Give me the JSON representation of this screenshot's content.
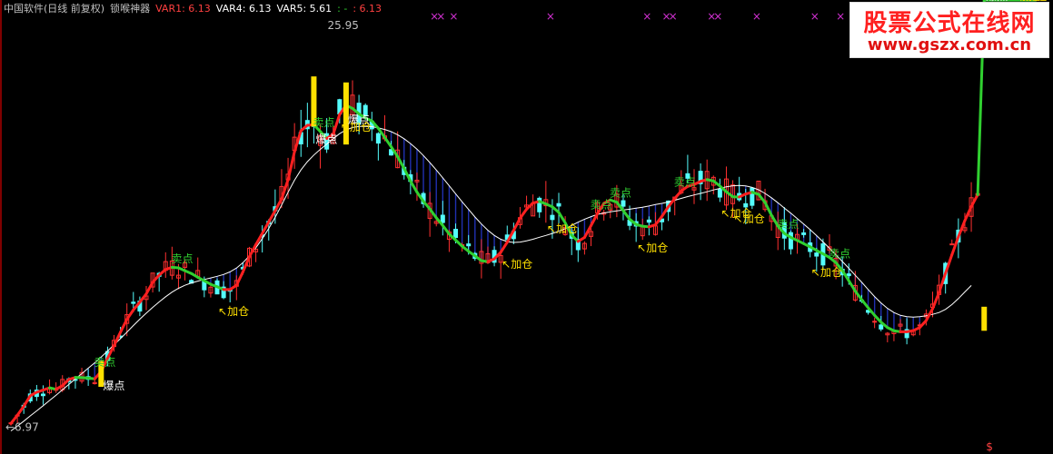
{
  "header": {
    "title": "中国软件(日线 前复权)",
    "indicator": "锁喉神器",
    "var1_label": "VAR1: 6.13",
    "var4_label": "VAR4: 6.13",
    "var5_label": "VAR5: 5.61",
    "extra_label": ": -",
    "extra_value": ": 6.13"
  },
  "watermark": {
    "title": "股票公式在线网",
    "url": "www.gszx.com.cn"
  },
  "colors": {
    "bg": "#000000",
    "up": "#ff3030",
    "down": "#54fcfc",
    "trend_up": "#ff2020",
    "trend_down": "#30d030",
    "slow_line": "#ffffff",
    "fill": "#2030b0",
    "burst_bar": "#ffe000",
    "label_yellow": "#ffffff",
    "label_green": "#30d030",
    "label_jiacang": "#ffe000",
    "header_gray": "#c0c0c0",
    "header_red": "#ff4040",
    "header_white": "#ffffff",
    "header_green": "#30d030"
  },
  "chart_data": {
    "type": "candlestick",
    "title": "中国软件(日线 前复权)",
    "y_high_label": "25.95",
    "y_low_label": "6.97",
    "ylim": [
      5.9,
      27.3
    ],
    "n_bars": 160,
    "trend_line": [
      6.97,
      7.38,
      7.83,
      8.35,
      8.53,
      8.64,
      8.75,
      8.68,
      8.86,
      9.17,
      9.27,
      9.26,
      9.24,
      9.2,
      9.57,
      10.23,
      10.86,
      11.53,
      12.17,
      12.64,
      13.03,
      13.44,
      14.02,
      14.38,
      14.66,
      14.77,
      14.74,
      14.6,
      14.46,
      14.27,
      14.1,
      13.92,
      13.8,
      13.66,
      13.66,
      13.87,
      14.54,
      15.3,
      15.9,
      16.46,
      17.03,
      17.59,
      18.19,
      19.14,
      20.54,
      21.59,
      21.86,
      21.89,
      21.55,
      21.2,
      21.41,
      22.4,
      22.86,
      22.7,
      22.43,
      22.22,
      22.08,
      21.71,
      21.25,
      20.79,
      20.29,
      19.71,
      19.07,
      18.52,
      18.06,
      17.68,
      17.24,
      16.86,
      16.43,
      16.13,
      15.82,
      15.57,
      15.34,
      15.1,
      15.05,
      15.19,
      15.52,
      16.02,
      16.61,
      17.22,
      17.67,
      17.98,
      18.06,
      17.93,
      17.79,
      17.51,
      16.99,
      16.37,
      16.06,
      16.26,
      16.85,
      17.45,
      17.96,
      18.13,
      18.02,
      17.6,
      17.17,
      16.91,
      16.82,
      16.79,
      16.89,
      17.31,
      17.79,
      18.21,
      18.58,
      18.81,
      18.9,
      19.06,
      19.15,
      19.08,
      18.83,
      18.54,
      18.29,
      18.28,
      18.43,
      18.52,
      18.41,
      18.01,
      17.37,
      16.83,
      16.46,
      16.26,
      16.11,
      15.95,
      15.79,
      15.61,
      15.44,
      15.26,
      15.0,
      14.61,
      14.1,
      13.58,
      13.15,
      12.75,
      12.37,
      12.03,
      11.76,
      11.6,
      11.55,
      11.55,
      11.61,
      11.76,
      12.11,
      12.7,
      13.51,
      14.47,
      15.4,
      16.29,
      17.1,
      17.8,
      18.4
    ],
    "slow_line": [
      6.6,
      6.84,
      7.09,
      7.35,
      7.6,
      7.86,
      8.12,
      8.38,
      8.65,
      8.92,
      9.19,
      9.46,
      9.73,
      10.0,
      10.29,
      10.59,
      10.9,
      11.21,
      11.53,
      11.86,
      12.18,
      12.48,
      12.77,
      13.04,
      13.3,
      13.53,
      13.72,
      13.87,
      13.99,
      14.08,
      14.16,
      14.24,
      14.32,
      14.41,
      14.54,
      14.73,
      15.0,
      15.34,
      15.74,
      16.2,
      16.71,
      17.27,
      17.88,
      18.52,
      19.12,
      19.63,
      20.04,
      20.37,
      20.66,
      20.92,
      21.19,
      21.44,
      21.63,
      21.75,
      21.8,
      21.8,
      21.79,
      21.73,
      21.65,
      21.54,
      21.39,
      21.19,
      20.95,
      20.67,
      20.35,
      20.0,
      19.63,
      19.24,
      18.84,
      18.44,
      18.04,
      17.66,
      17.28,
      16.93,
      16.62,
      16.36,
      16.17,
      16.05,
      16.01,
      16.03,
      16.09,
      16.17,
      16.27,
      16.36,
      16.46,
      16.57,
      16.7,
      16.86,
      17.02,
      17.17,
      17.3,
      17.41,
      17.48,
      17.54,
      17.59,
      17.63,
      17.67,
      17.72,
      17.77,
      17.83,
      17.9,
      17.96,
      18.03,
      18.12,
      18.21,
      18.3,
      18.38,
      18.46,
      18.54,
      18.63,
      18.71,
      18.79,
      18.84,
      18.86,
      18.83,
      18.76,
      18.64,
      18.46,
      18.24,
      17.99,
      17.73,
      17.47,
      17.2,
      16.93,
      16.65,
      16.35,
      16.04,
      15.72,
      15.39,
      15.06,
      14.72,
      14.37,
      14.02,
      13.66,
      13.31,
      12.99,
      12.72,
      12.51,
      12.37,
      12.3,
      12.28,
      12.3,
      12.35,
      12.42,
      12.51,
      12.67,
      12.91,
      13.21,
      13.54,
      13.86
    ],
    "burst_bars": [
      {
        "bar": 14,
        "low": 8.8,
        "high": 10.1
      },
      {
        "bar": 47,
        "low": 21.8,
        "high": 24.3
      },
      {
        "bar": 52,
        "low": 20.9,
        "high": 24.0
      },
      {
        "bar": 151,
        "low": 11.6,
        "high": 12.8
      }
    ],
    "labels": {
      "burst": "爆点",
      "sell": "卖点",
      "add": "↖加仓"
    },
    "burst_points": [
      14,
      47,
      52,
      151
    ],
    "sell_points": [
      14,
      26,
      48,
      91,
      94,
      104,
      120,
      128
    ],
    "add_points": [
      33,
      52,
      77,
      84,
      98,
      111,
      113,
      125,
      156,
      157
    ],
    "header_marks": [
      65,
      66,
      68,
      83,
      98,
      101,
      102,
      108,
      109,
      115,
      124,
      128,
      133
    ]
  }
}
